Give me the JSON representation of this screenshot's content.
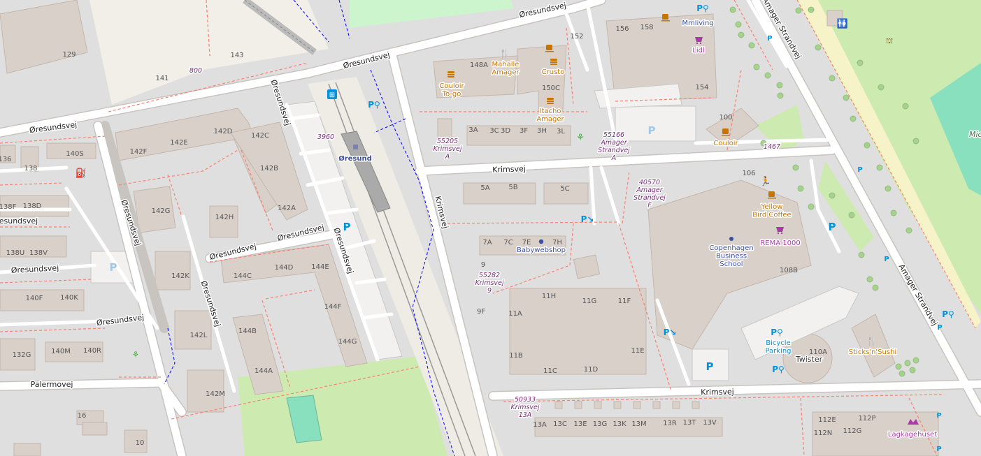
{
  "map": {
    "streets": {
      "oresundsvej": "Øresundsvej",
      "krimsvej": "Krimsvej",
      "amager_strandvej": "Amager Strandvej",
      "palermovej": "Palermovej"
    },
    "station": "Øresund",
    "pois": {
      "couloir": "Couloir\nTo-go",
      "mahalle": "Mahalle\nAmager",
      "crusto": "Crusto",
      "itacho": "Itacho\nAmager",
      "mmliving": "Mmliving",
      "lidl": "Lidl",
      "couloir2": "Couloir",
      "yellow_bird": "Yellow\nBird Coffee",
      "rema": "REMA 1000",
      "cbs": "Copenhagen\nBusiness\nSchool",
      "babywebshop": "Babywebshop",
      "bicycle_parking": "Bicycle\nParking",
      "twister": "Twister",
      "sticks": "Sticks'n'Sushi",
      "lagkagehuset": "Lagkagehuset",
      "mic": "Mic"
    },
    "addresses": {
      "a55205": "55205\nKrimsvej\nA",
      "a55166": "55166\nAmager\nStrandvej\nA",
      "a40570": "40570\nAmager\nStrandvej\nF",
      "a55282": "55282\nKrimsvej\n9",
      "a50933": "50933\nKrimsvej\n13A",
      "n800": "800",
      "n3960": "3960",
      "n1467": "1467"
    },
    "house_numbers": {
      "h129": "129",
      "h143": "143",
      "h141": "141",
      "h152": "152",
      "h156": "156",
      "h158": "158",
      "h148A": "148A",
      "h150C": "150C",
      "h154": "154",
      "h100": "100",
      "h142D": "142D",
      "h142C": "142C",
      "h142F": "142F",
      "h142E": "142E",
      "h142B": "142B",
      "h142A": "142A",
      "h142G": "142G",
      "h142H": "142H",
      "h142K": "142K",
      "h142L": "142L",
      "h142M": "142M",
      "h140S": "140S",
      "h136": "136",
      "h138": "138",
      "h138F": "138F",
      "h138D": "138D",
      "h138U": "138U",
      "h138V": "138V",
      "h140F": "140F",
      "h140K": "140K",
      "h132G": "132G",
      "h140M": "140M",
      "h140R": "140R",
      "h144C": "144C",
      "h144D": "144D",
      "h144E": "144E",
      "h144F": "144F",
      "h144G": "144G",
      "h144B": "144B",
      "h144A": "144A",
      "h3A": "3A",
      "h3C": "3C",
      "h3D": "3D",
      "h3F": "3F",
      "h3H": "3H",
      "h3L": "3L",
      "h5A": "5A",
      "h5B": "5B",
      "h5C": "5C",
      "h7A": "7A",
      "h7C": "7C",
      "h7E": "7E",
      "h7H": "7H",
      "h9": "9",
      "h9F": "9F",
      "h11H": "11H",
      "h11G": "11G",
      "h11F": "11F",
      "h11A": "11A",
      "h11B": "11B",
      "h11E": "11E",
      "h11C": "11C",
      "h11D": "11D",
      "h13A": "13A",
      "h13C": "13C",
      "h13E": "13E",
      "h13G": "13G",
      "h13K": "13K",
      "h13M": "13M",
      "h13R": "13R",
      "h13T": "13T",
      "h13V": "13V",
      "h106": "106",
      "h108B": "108B",
      "h110A": "110A",
      "h112E": "112E",
      "h112P": "112P",
      "h112N": "112N",
      "h112G": "112G",
      "h16": "16",
      "h10": "10"
    },
    "colors": {
      "background": "#e0dfdf",
      "building": "#d9d0c9",
      "road": "#ffffff",
      "park": "#cdebb0",
      "pitch": "#88e0be",
      "food": "#c77400",
      "shop": "#ac39ac",
      "transport": "#0092da",
      "amenity_text": "#734a08",
      "footway": "#fa8072"
    }
  }
}
